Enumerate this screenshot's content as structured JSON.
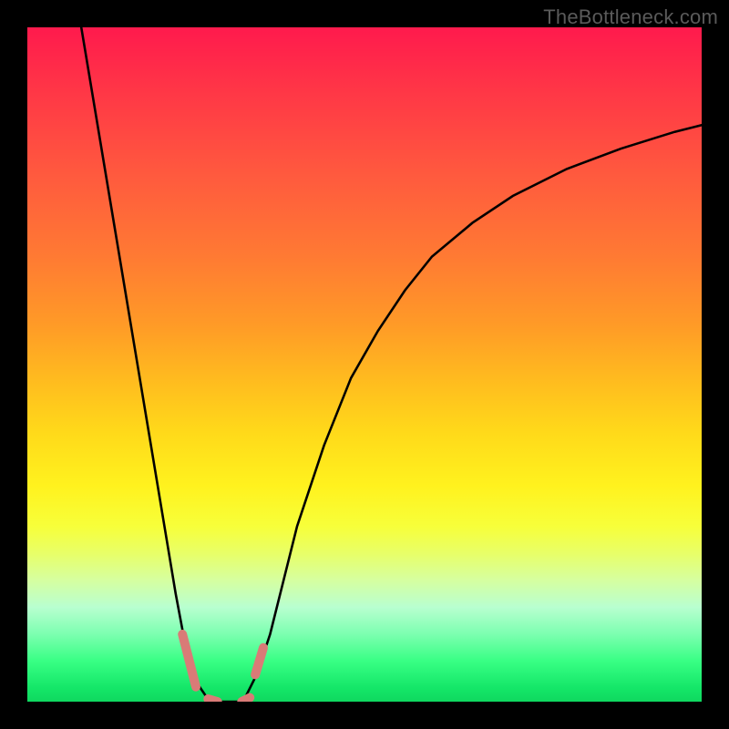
{
  "watermark": "TheBottleneck.com",
  "chart_data": {
    "type": "line",
    "title": "",
    "xlabel": "",
    "ylabel": "",
    "xlim": [
      0,
      100
    ],
    "ylim": [
      0,
      100
    ],
    "grid": false,
    "legend": false,
    "series": [
      {
        "name": "left-branch",
        "x": [
          8,
          10,
          12,
          14,
          16,
          18,
          20,
          22,
          23.5,
          25,
          26.5,
          28
        ],
        "y": [
          100,
          88,
          76,
          64,
          52,
          40,
          28,
          16,
          8,
          3,
          0.8,
          0
        ]
      },
      {
        "name": "right-branch",
        "x": [
          32,
          34,
          36,
          38,
          40,
          44,
          48,
          52,
          56,
          60,
          66,
          72,
          80,
          88,
          96,
          100
        ],
        "y": [
          0,
          4,
          10,
          18,
          26,
          38,
          48,
          55,
          61,
          66,
          71,
          75,
          79,
          82,
          84.5,
          85.5
        ]
      }
    ],
    "highlight_segments": [
      {
        "name": "left-marker",
        "x": [
          23.0,
          25.0
        ],
        "y": [
          10.0,
          2.2
        ]
      },
      {
        "name": "floor-left",
        "x": [
          26.8,
          28.2
        ],
        "y": [
          0.4,
          0.0
        ]
      },
      {
        "name": "floor-right",
        "x": [
          31.8,
          33.0
        ],
        "y": [
          0.0,
          0.6
        ]
      },
      {
        "name": "right-marker",
        "x": [
          33.8,
          35.0
        ],
        "y": [
          4.0,
          8.0
        ]
      }
    ],
    "colors": {
      "curve": "#000000",
      "highlight": "#d97b77"
    }
  }
}
